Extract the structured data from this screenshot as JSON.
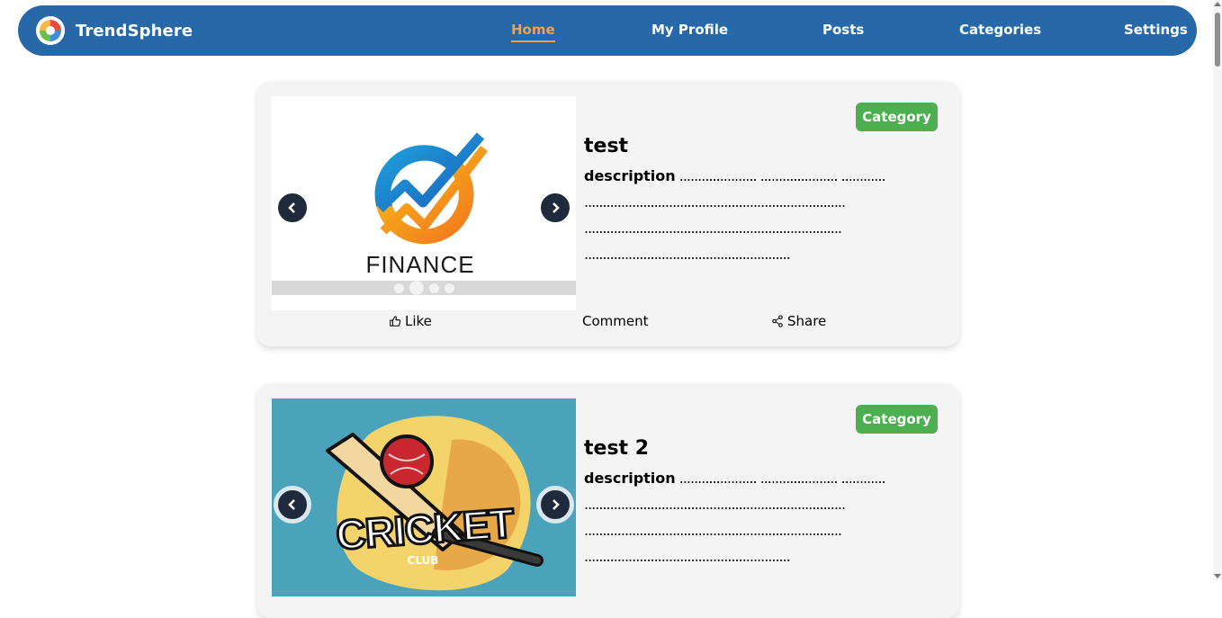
{
  "nav": {
    "brand": "TrendSphere",
    "items": [
      {
        "label": "Home",
        "active": true
      },
      {
        "label": "My Profile",
        "active": false
      },
      {
        "label": "Posts",
        "active": false
      },
      {
        "label": "Categories",
        "active": false
      },
      {
        "label": "Settings",
        "active": false
      }
    ]
  },
  "posts": [
    {
      "category": "Category",
      "title": "test",
      "description_label": "description",
      "description_lines": [
        " ..................... ..................... ............",
        ".......................................................................",
        "......................................................................",
        "........................................................"
      ],
      "image_caption": "FINANCE",
      "actions": {
        "like": "Like",
        "comment": "Comment",
        "share": "Share"
      }
    },
    {
      "category": "Category",
      "title": "test 2",
      "description_label": "description",
      "description_lines": [
        " ..................... ..................... ............",
        ".......................................................................",
        "......................................................................",
        "........................................................"
      ],
      "image_caption": "CRICKET",
      "image_subcaption": "CLUB"
    }
  ],
  "colors": {
    "navbar": "#2769a8",
    "active_link": "#f0a14a",
    "badge": "#4caf50",
    "card": "#f4f4f4"
  }
}
